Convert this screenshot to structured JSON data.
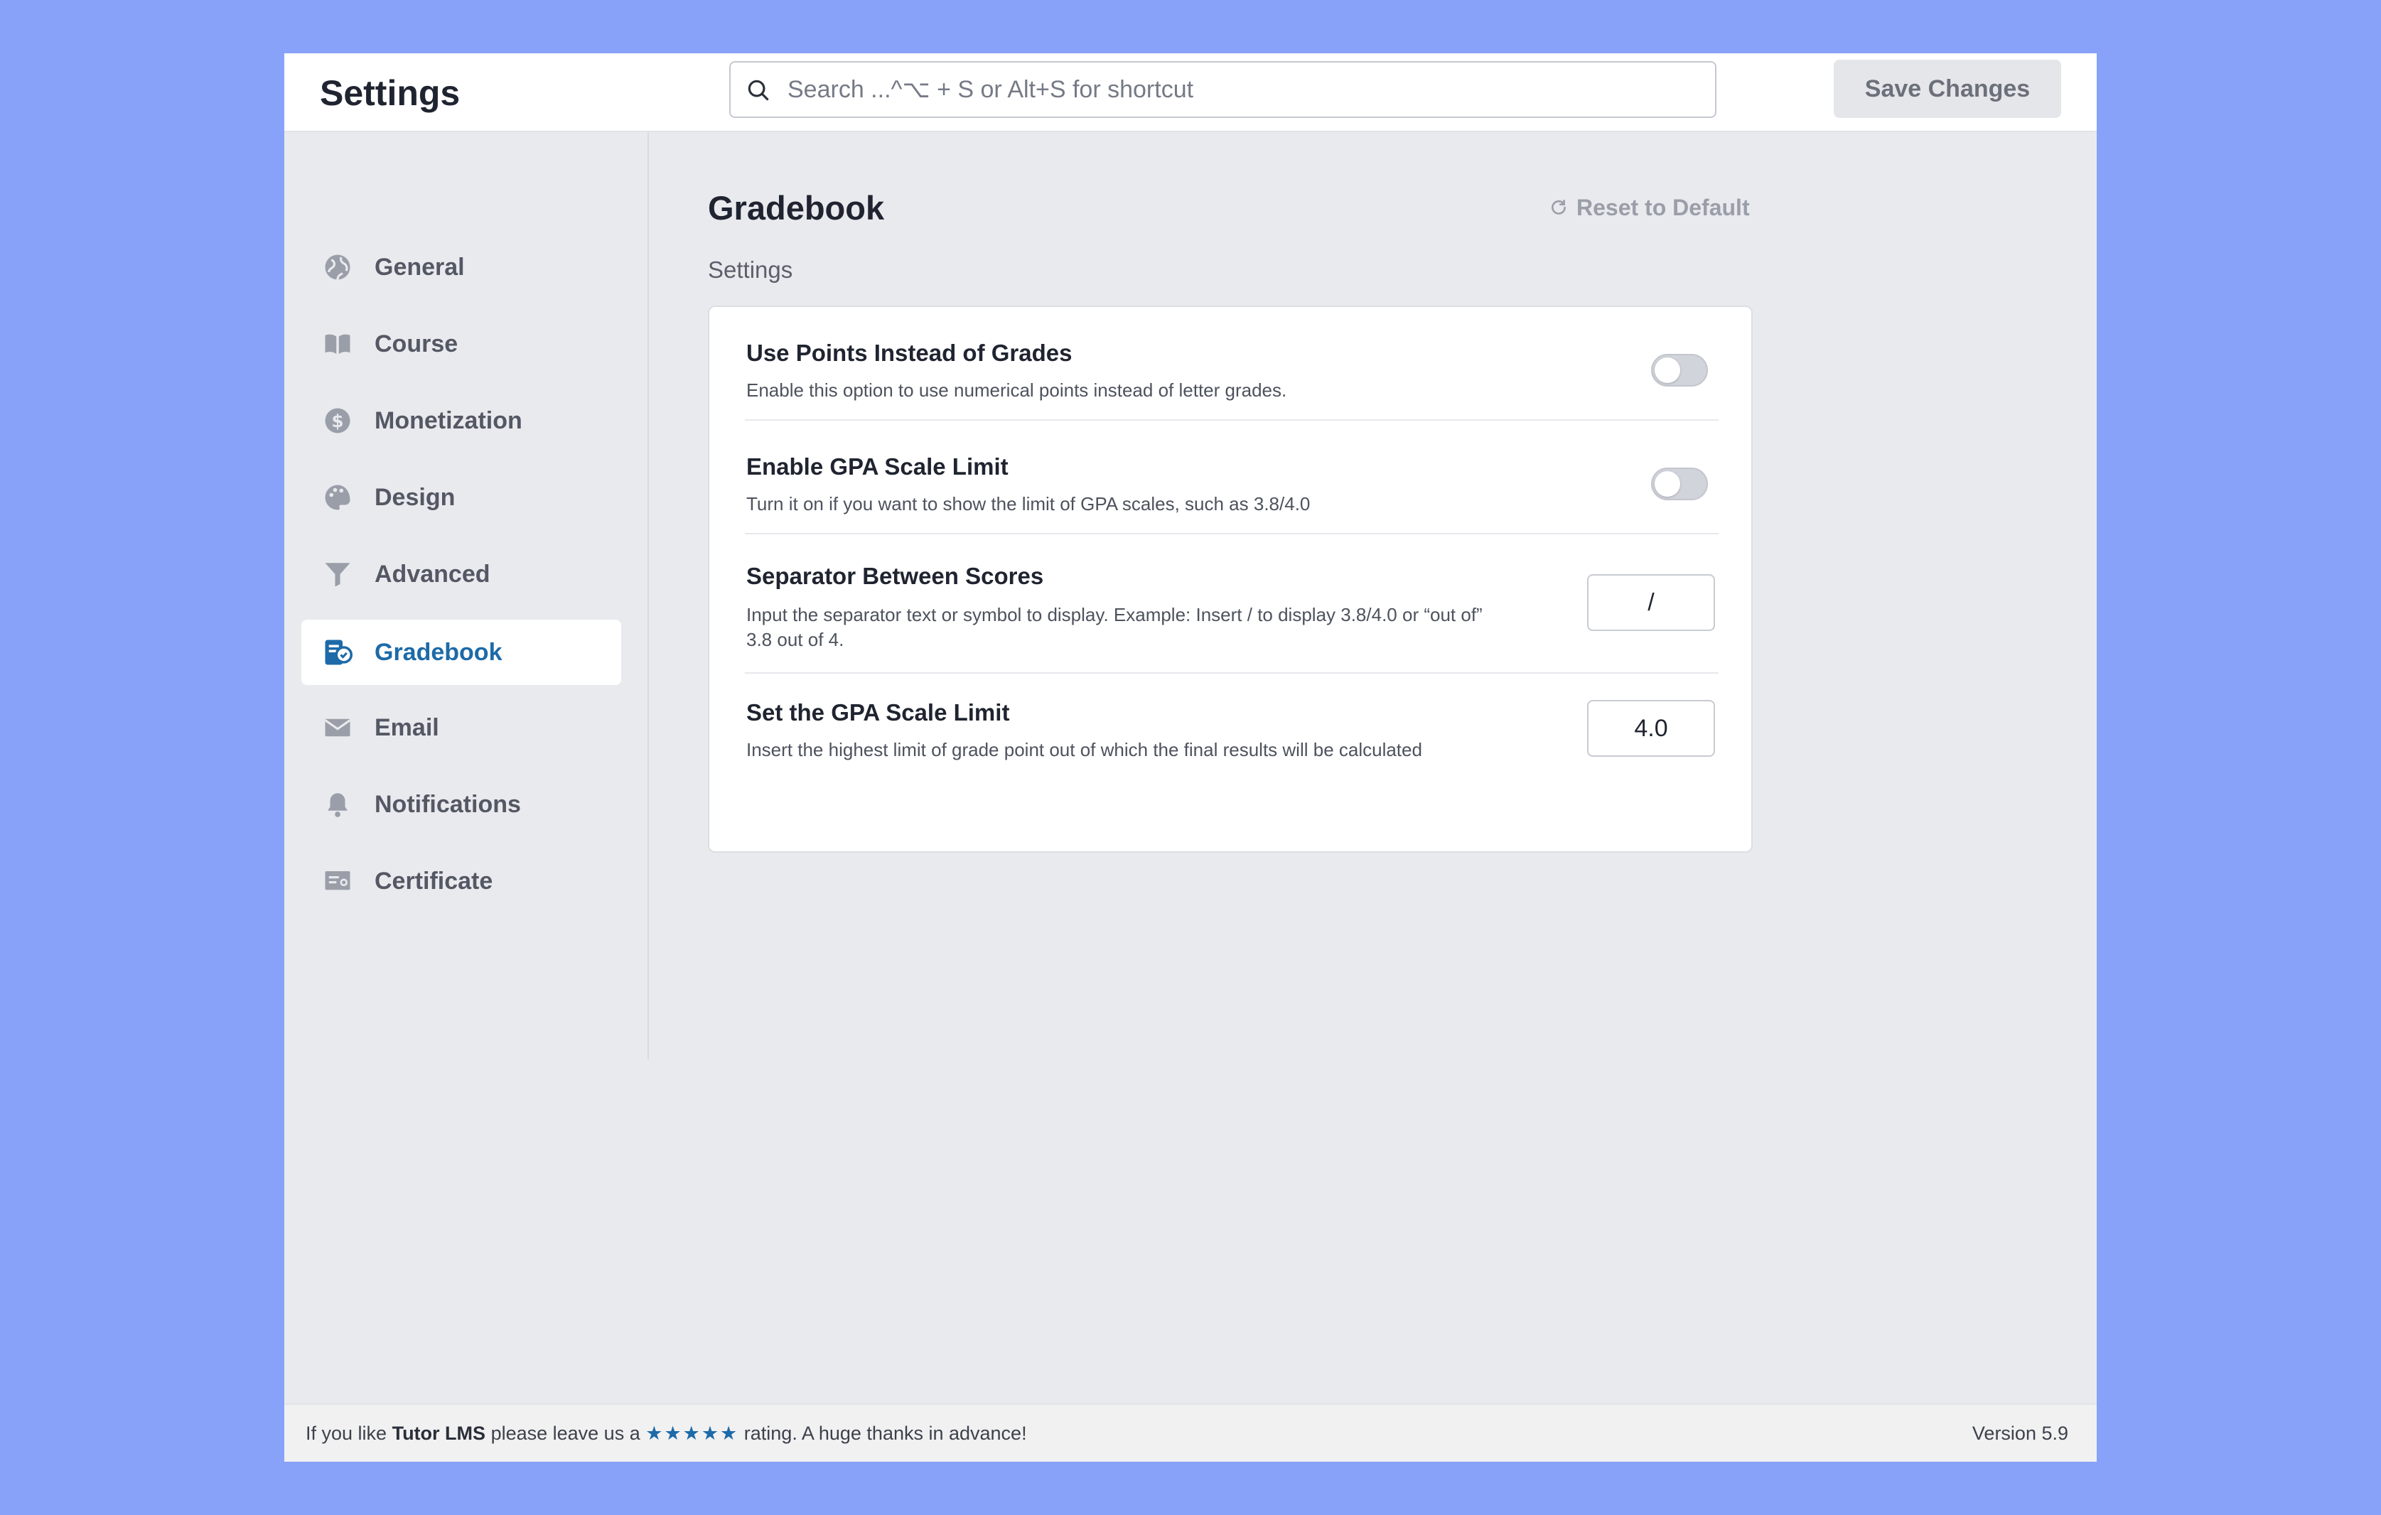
{
  "header": {
    "title": "Settings",
    "search_placeholder": "Search ...^⌥ + S or Alt+S for shortcut",
    "save_label": "Save Changes"
  },
  "sidebar": {
    "items": [
      {
        "label": "General",
        "icon": "globe-icon"
      },
      {
        "label": "Course",
        "icon": "book-icon"
      },
      {
        "label": "Monetization",
        "icon": "dollar-icon"
      },
      {
        "label": "Design",
        "icon": "palette-icon"
      },
      {
        "label": "Advanced",
        "icon": "filter-icon"
      },
      {
        "label": "Gradebook",
        "icon": "gradebook-icon",
        "active": true
      },
      {
        "label": "Email",
        "icon": "envelope-icon"
      },
      {
        "label": "Notifications",
        "icon": "bell-icon"
      },
      {
        "label": "Certificate",
        "icon": "certificate-icon"
      }
    ]
  },
  "main": {
    "title": "Gradebook",
    "reset_label": "Reset to Default",
    "section_label": "Settings",
    "settings": [
      {
        "title": "Use Points Instead of Grades",
        "description": "Enable this option to use numerical points instead of letter grades.",
        "control": "toggle",
        "value": false
      },
      {
        "title": "Enable GPA Scale Limit",
        "description": "Turn it on if you want to show the limit of GPA scales, such as 3.8/4.0",
        "control": "toggle",
        "value": false
      },
      {
        "title": "Separator Between Scores",
        "description_line1": "Input the separator text or symbol to display. Example: Insert / to display 3.8/4.0 or “out of”",
        "description_line2": "3.8 out of 4.",
        "control": "input",
        "value": "/"
      },
      {
        "title": "Set the GPA Scale Limit",
        "description": "Insert the highest limit of grade point out of which the final results will be calculated",
        "control": "input",
        "value": "4.0"
      }
    ]
  },
  "footer": {
    "text_before": "If you like",
    "brand": "Tutor LMS",
    "text_mid": "please leave us a",
    "stars": "★★★★★",
    "text_after": "rating. A huge thanks in advance!",
    "version": "Version 5.9"
  },
  "colors": {
    "background": "#87a2f8",
    "accent": "#1d6aa8",
    "panel": "#e9eaee"
  }
}
